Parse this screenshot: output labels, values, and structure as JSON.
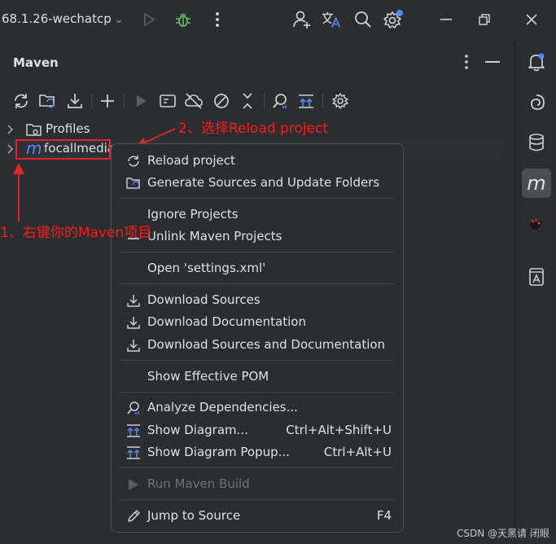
{
  "titlebar": {
    "project_name": "68.1.26-wechatcp"
  },
  "panel": {
    "title": "Maven"
  },
  "tree": {
    "profiles_label": "Profiles",
    "project_label": "focallmedia"
  },
  "annotations": {
    "step1": "1、右键你的Maven项目",
    "step2": "2、选择Reload project"
  },
  "menu": {
    "reload": "Reload project",
    "generate": "Generate Sources and Update Folders",
    "ignore": "Ignore Projects",
    "unlink": "Unlink Maven Projects",
    "open_settings": "Open 'settings.xml'",
    "download_sources": "Download Sources",
    "download_docs": "Download Documentation",
    "download_both": "Download Sources and Documentation",
    "show_pom": "Show Effective POM",
    "analyze": "Analyze Dependencies...",
    "show_diagram": "Show Diagram...",
    "show_diagram_sc": "Ctrl+Alt+Shift+U",
    "show_popup": "Show Diagram Popup...",
    "show_popup_sc": "Ctrl+Alt+U",
    "run_build": "Run Maven Build",
    "jump": "Jump to Source",
    "jump_sc": "F4"
  },
  "icons": {
    "run": "run-icon",
    "debug": "debug-icon",
    "more": "more-vertical-icon",
    "add_user": "add-user-icon",
    "translate": "translate-icon",
    "search": "search-icon",
    "settings": "gear-icon",
    "accent_green": "#5fb865",
    "accent_blue": "#548af7",
    "annotation_red": "#ff1a1a"
  },
  "watermark": "CSDN @天黑请 闭眼"
}
